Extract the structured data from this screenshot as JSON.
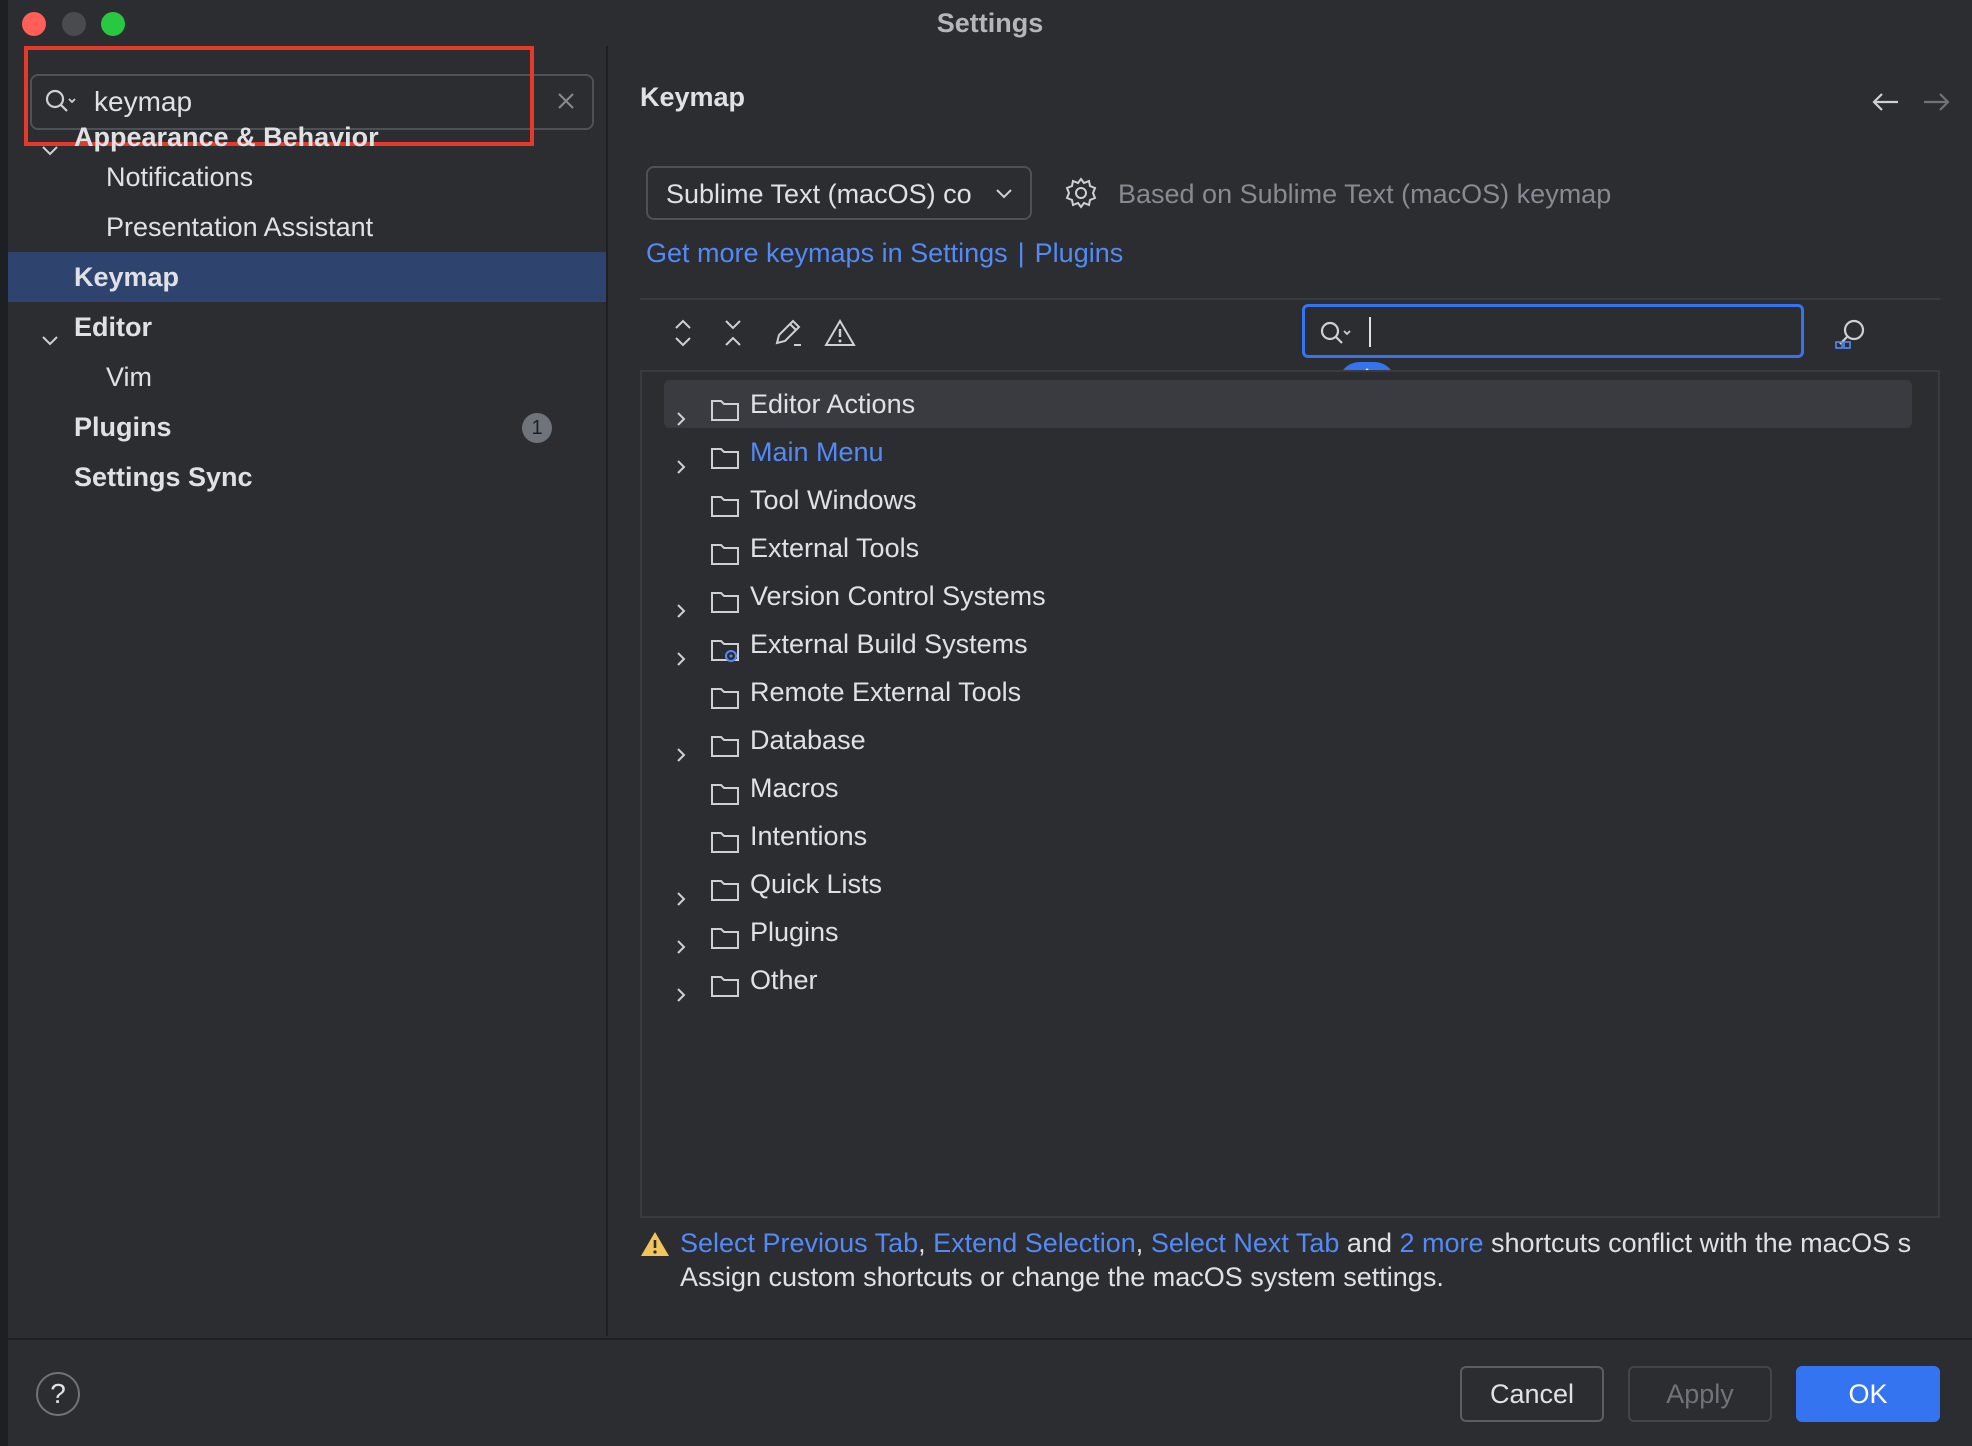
{
  "window": {
    "title": "Settings"
  },
  "sidebar": {
    "search": {
      "value": "keymap"
    },
    "items": [
      {
        "label": "Appearance & Behavior",
        "level": 0,
        "expanded": true
      },
      {
        "label": "Notifications",
        "level": 1
      },
      {
        "label": "Presentation Assistant",
        "level": 1
      },
      {
        "label": "Keymap",
        "level": 0,
        "selected": true
      },
      {
        "label": "Editor",
        "level": 0,
        "expanded": true
      },
      {
        "label": "Vim",
        "level": 1
      },
      {
        "label": "Plugins",
        "level": 0,
        "badge": "1"
      },
      {
        "label": "Settings Sync",
        "level": 0
      }
    ]
  },
  "main": {
    "title": "Keymap",
    "keymap_select": {
      "value": "Sublime Text (macOS) co"
    },
    "based_on": "Based on Sublime Text (macOS) keymap",
    "links": {
      "get_more": "Get more keymaps in Settings",
      "separator": "|",
      "plugins": "Plugins"
    },
    "tree": [
      {
        "label": "Editor Actions",
        "expandable": true,
        "hovered": true
      },
      {
        "label": "Main Menu",
        "expandable": true,
        "link": true
      },
      {
        "label": "Tool Windows",
        "expandable": false
      },
      {
        "label": "External Tools",
        "expandable": false
      },
      {
        "label": "Version Control Systems",
        "expandable": true
      },
      {
        "label": "External Build Systems",
        "expandable": true,
        "icon": "folder-gear-icon"
      },
      {
        "label": "Remote External Tools",
        "expandable": false
      },
      {
        "label": "Database",
        "expandable": true
      },
      {
        "label": "Macros",
        "expandable": false
      },
      {
        "label": "Intentions",
        "expandable": false
      },
      {
        "label": "Quick Lists",
        "expandable": true
      },
      {
        "label": "Plugins",
        "expandable": true
      },
      {
        "label": "Other",
        "expandable": true
      }
    ],
    "warning": {
      "link1": "Select Previous Tab",
      "sep1": ", ",
      "link2": "Extend Selection",
      "sep2": ", ",
      "link3": "Select Next Tab",
      "and": " and ",
      "link4": "2 more",
      "rest": " shortcuts conflict with the macOS s",
      "line2": "Assign custom shortcuts or change the macOS system settings."
    }
  },
  "footer": {
    "help": "?",
    "cancel": "Cancel",
    "apply": "Apply",
    "ok": "OK"
  },
  "colors": {
    "accent": "#3574f0",
    "link": "#548af7",
    "highlight": "#e53a2b",
    "selected": "#2e436e"
  }
}
